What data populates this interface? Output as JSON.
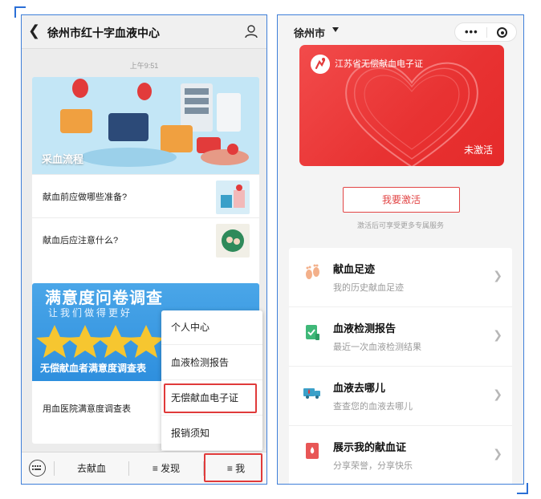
{
  "left_screen": {
    "header": {
      "title": "徐州市红十字血液中心"
    },
    "timestamp": "上午9:51",
    "article1": {
      "banner_caption": "采血流程",
      "items": [
        {
          "label": "献血前应做哪些准备?"
        },
        {
          "label": "献血后应注意什么?"
        }
      ]
    },
    "article2": {
      "banner_title": "满意度问卷调查",
      "banner_subtitle": "让我们做得更好",
      "banner_caption": "无偿献血者满意度调查表",
      "item_label": "用血医院满意度调查表"
    },
    "popup_menu": {
      "items": [
        {
          "label": "个人中心"
        },
        {
          "label": "血液检测报告"
        },
        {
          "label": "无偿献血电子证"
        },
        {
          "label": "报销须知"
        }
      ],
      "highlighted_index": 2
    },
    "bottom_menu": {
      "tabs": [
        {
          "label": "去献血"
        },
        {
          "label": "≡ 发现"
        },
        {
          "label": "≡ 我"
        }
      ],
      "highlighted_tab": "≡ 我"
    }
  },
  "right_screen": {
    "city": "徐州市",
    "capsule": {
      "more": "•••"
    },
    "card": {
      "title": "江苏省无偿献血电子证",
      "status": "未激活"
    },
    "activate_button": "我要激活",
    "activate_hint": "激活后可享受更多专属服务",
    "features": [
      {
        "title": "献血足迹",
        "subtitle": "我的历史献血足迹",
        "icon": "footprints-icon"
      },
      {
        "title": "血液检测报告",
        "subtitle": "最近一次血液检测结果",
        "icon": "report-check-icon"
      },
      {
        "title": "血液去哪儿",
        "subtitle": "查查您的血液去哪儿",
        "icon": "blood-truck-icon"
      },
      {
        "title": "展示我的献血证",
        "subtitle": "分享荣誉，分享快乐",
        "icon": "blood-drop-card-icon"
      }
    ]
  },
  "colors": {
    "accent_red": "#e83232",
    "highlight_border": "#e03a3a",
    "frame_blue": "#3f7fd9",
    "banner_blue": "#2e8fde"
  }
}
